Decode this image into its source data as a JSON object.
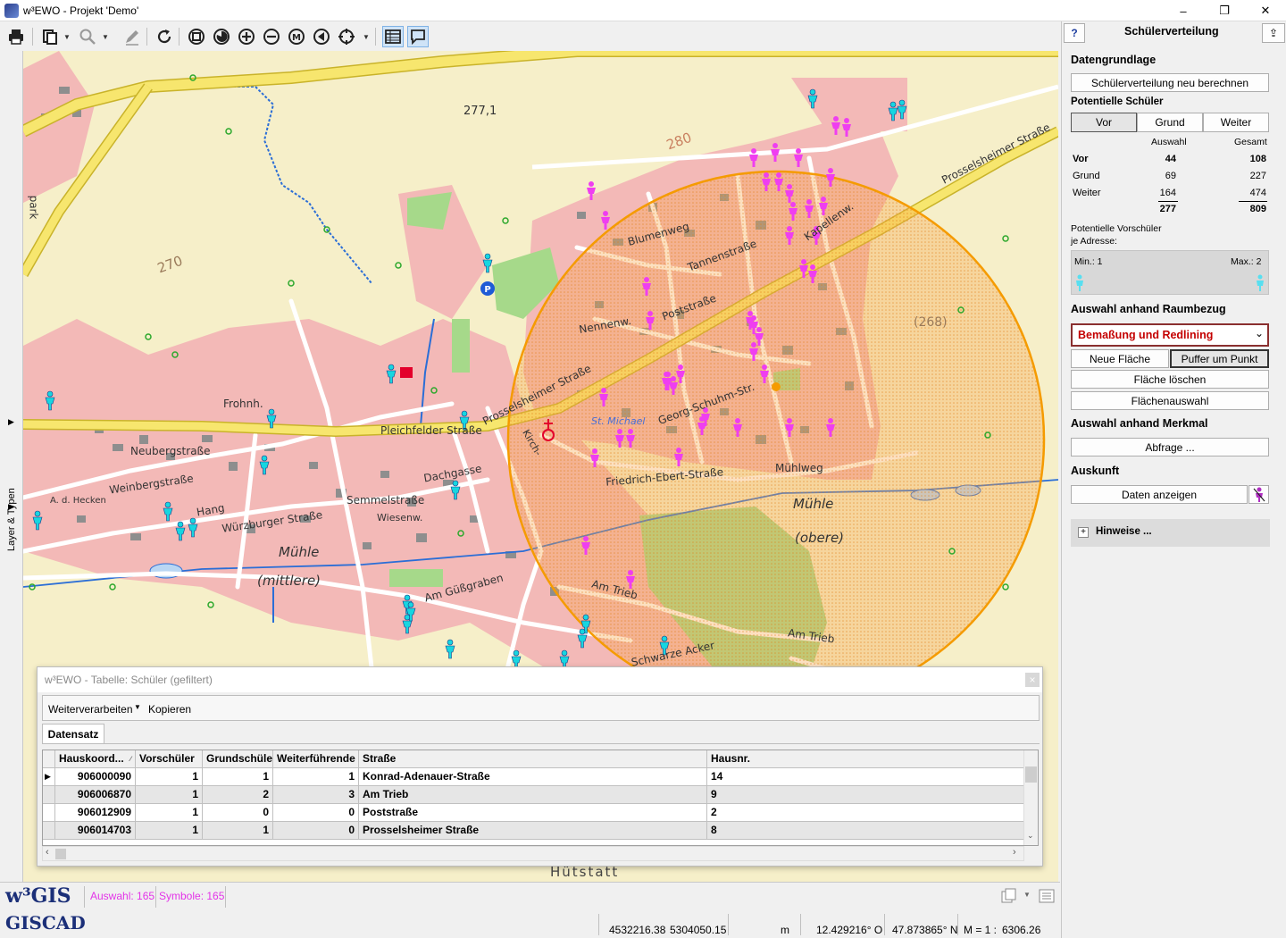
{
  "window": {
    "title": "w³EWO - Projekt 'Demo'",
    "minimize": "–",
    "restore": "❐",
    "close": "✕"
  },
  "toolbar": {
    "icons": [
      "print-icon",
      "copy-icon",
      "zoom-icon",
      "edit-icon",
      "refresh-icon",
      "zoom-full-icon",
      "zoom-previous-icon",
      "zoom-in-icon",
      "zoom-out-icon",
      "measure-icon",
      "back-icon",
      "center-icon",
      "table-icon",
      "comment-icon"
    ]
  },
  "sidebar": {
    "layer_tab": "Layer & Typen"
  },
  "map": {
    "colors": {
      "background": "#f6efc9",
      "settlement": "#f3b9b7",
      "road_major": "#f7e66e",
      "road_minor": "#ffffff",
      "buffer_fill": "#f5a54a",
      "buffer_stroke": "#f59b00",
      "green": "#a6d98a",
      "water": "#2b6ed6",
      "marker_pink": "#ef3ef0",
      "marker_cyan": "#17d6e0"
    },
    "labels": {
      "elevation_277": "277,1",
      "elevation_270": "270",
      "elevation_268": "(268)",
      "elevation_280": "280",
      "street_prosselsheimer_1": "Prosselsheimer Straße",
      "street_prosselsheimer_2": "Prosselsheimer Straße",
      "street_pleichfelder": "Pleichfelder Straße",
      "street_weinberg": "Weinbergstraße",
      "street_neuberg": "Neubergstraße",
      "street_wuerzburger": "Würzburger Straße",
      "street_semmel": "Semmelstraße",
      "street_dachgasse": "Dachgasse",
      "street_friedrich_ebert": "Friedrich-Ebert-Straße",
      "street_muehlweg": "Mühlweg",
      "street_am_trieb_1": "Am Trieb",
      "street_am_trieb_2": "Am Trieb",
      "street_blumenweg": "Blumenweg",
      "street_tannen": "Tannenstraße",
      "street_post": "Poststraße",
      "street_george_schuh": "Georg-Schuhm-Str.",
      "street_kappellenweg": "Kapellenw.",
      "street_frohnen": "Frohnh.",
      "street_am_guessgraben": "Am Güßgraben",
      "street_schwarze_acker": "Schwarze Acker",
      "street_schmelzgasse": "Hang",
      "street_wiesenw": "Wiesenw.",
      "street_kirch": "Kirch-",
      "street_neuwiesenw": "Nennenw.",
      "muehle_1": "Mühle",
      "muehle_1_sub": "(mittlere)",
      "muehle_2": "Mühle",
      "muehle_2_sub": "(obere)",
      "church": "St. Michael",
      "hecken": "A. d. Hecken",
      "hutstatt": "Hütstatt",
      "park": "park"
    }
  },
  "panel": {
    "help_button": "?",
    "title": "Schülerverteilung",
    "section_data": "Datengrundlage",
    "recalc_button": "Schülerverteilung neu berechnen",
    "potential_label": "Potentielle Schüler",
    "tabs": [
      "Vor",
      "Grund",
      "Weiter"
    ],
    "col_selection": "Auswahl",
    "col_total": "Gesamt",
    "stats": [
      {
        "label": "Vor",
        "selection": "44",
        "total": "108"
      },
      {
        "label": "Grund",
        "selection": "69",
        "total": "227"
      },
      {
        "label": "Weiter",
        "selection": "164",
        "total": "474"
      }
    ],
    "sum_selection": "277",
    "sum_total": "809",
    "per_address_label_1": "Potentielle Vorschüler",
    "per_address_label_2": "je Adresse:",
    "slider_min": "Min.: 1",
    "slider_max": "Max.: 2",
    "section_spatial": "Auswahl anhand Raumbezug",
    "spatial_select": "Bemaßung und Redlining",
    "new_area_button": "Neue Fläche",
    "buffer_point_button": "Puffer um Punkt",
    "delete_area_button": "Fläche löschen",
    "area_selection_button": "Flächenauswahl",
    "section_attribute": "Auswahl anhand Merkmal",
    "query_button": "Abfrage ...",
    "section_info": "Auskunft",
    "show_data_button": "Daten anzeigen",
    "hints_label": "Hinweise ...",
    "hints_expander": "+"
  },
  "table_window": {
    "title": "w³EWO - Tabelle: Schüler (gefiltert)",
    "close": "×",
    "menu_process": "Weiterverarbeiten",
    "menu_copy": "Kopieren",
    "tab": "Datensatz",
    "headers": [
      "Hauskoord...",
      "Vorschüler",
      "Grundschüler",
      "Weiterführende",
      "Straße",
      "Hausnr."
    ],
    "rows": [
      [
        "906000090",
        "1",
        "1",
        "1",
        "Konrad-Adenauer-Straße",
        "14"
      ],
      [
        "906006870",
        "1",
        "2",
        "3",
        "Am Trieb",
        "9"
      ],
      [
        "906012909",
        "1",
        "0",
        "0",
        "Poststraße",
        "2"
      ],
      [
        "906014703",
        "1",
        "1",
        "0",
        "Prosselsheimer Straße",
        "8"
      ]
    ]
  },
  "statusbar": {
    "logo_w3gis": "w³GIS",
    "logo_giscad": "GISCAD",
    "selection": "Auswahl: 165",
    "symbols": "Symbole: 165",
    "x": "4532216.38",
    "y": "5304050.15",
    "unit": "m",
    "lon": "12.429216° O",
    "lat": "47.873865° N",
    "scale_label": "M = 1 :",
    "scale": "6306.26"
  }
}
